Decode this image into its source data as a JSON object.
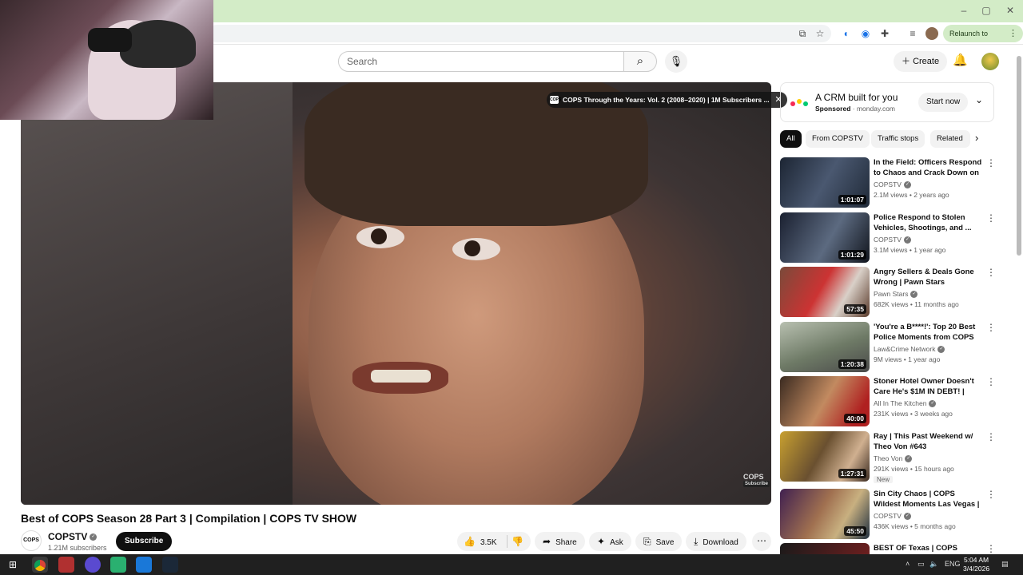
{
  "browser": {
    "relaunch_label": "Relaunch to update",
    "more_glyph": "⋮",
    "window_controls": [
      "–",
      "▢",
      "✕"
    ]
  },
  "header": {
    "search_placeholder": "Search",
    "create_label": "Create"
  },
  "player": {
    "playlist_banner": "COPS Through the Years: Vol. 2 (2008–2020) | 1M Subscribers ...",
    "playlist_icon_text": "COPS",
    "watermark": "COPS",
    "watermark_sub": "Subscribe"
  },
  "video": {
    "title": "Best of COPS Season 28 Part 3 | Compilation | COPS TV SHOW",
    "channel": "COPSTV",
    "channel_avatar_text": "COPS",
    "subscribers": "1.21M subscribers",
    "subscribe_label": "Subscribe",
    "likes": "3.5K",
    "share_label": "Share",
    "ask_label": "Ask",
    "save_label": "Save",
    "download_label": "Download"
  },
  "ad": {
    "title": "A CRM built for you",
    "sponsored": "Sponsored",
    "domain": "· monday.com",
    "cta": "Start now"
  },
  "chips": [
    "All",
    "From COPSTV",
    "Traffic stops",
    "Related"
  ],
  "recommendations": [
    {
      "title": "In the Field: Officers Respond to Chaos and Crack Down on ...",
      "channel": "COPSTV",
      "meta": "2.1M views • 2 years ago",
      "duration": "1:01:07"
    },
    {
      "title": "Police Respond to Stolen Vehicles, Shootings, and ...",
      "channel": "COPSTV",
      "meta": "3.1M views • 1 year ago",
      "duration": "1:01:29"
    },
    {
      "title": "Angry Sellers & Deals Gone Wrong | Pawn Stars",
      "channel": "Pawn Stars",
      "meta": "682K views • 11 months ago",
      "duration": "57:35"
    },
    {
      "title": "'You're a B****!': Top 20 Best Police Moments from COPS",
      "channel": "Law&Crime Network",
      "meta": "9M views • 1 year ago",
      "duration": "1:20:38"
    },
    {
      "title": "Stoner Hotel Owner Doesn't Care He's $1M IN DEBT! | Hote...",
      "channel": "All In The Kitchen",
      "meta": "231K views • 3 weeks ago",
      "duration": "40:00"
    },
    {
      "title": "Ray | This Past Weekend w/ Theo Von #643",
      "channel": "Theo Von",
      "meta": "291K views • 15 hours ago",
      "duration": "1:27:31",
      "badge": "New"
    },
    {
      "title": "Sin City Chaos | COPS Wildest Moments Las Vegas | ...",
      "channel": "COPSTV",
      "meta": "436K views • 5 months ago",
      "duration": "45:50"
    },
    {
      "title": "BEST OF Texas | COPS Wildest",
      "channel": "",
      "meta": "",
      "duration": ""
    }
  ],
  "taskbar": {
    "lang": "ENG",
    "time": "5:04 AM",
    "date": "3/4/2026"
  }
}
